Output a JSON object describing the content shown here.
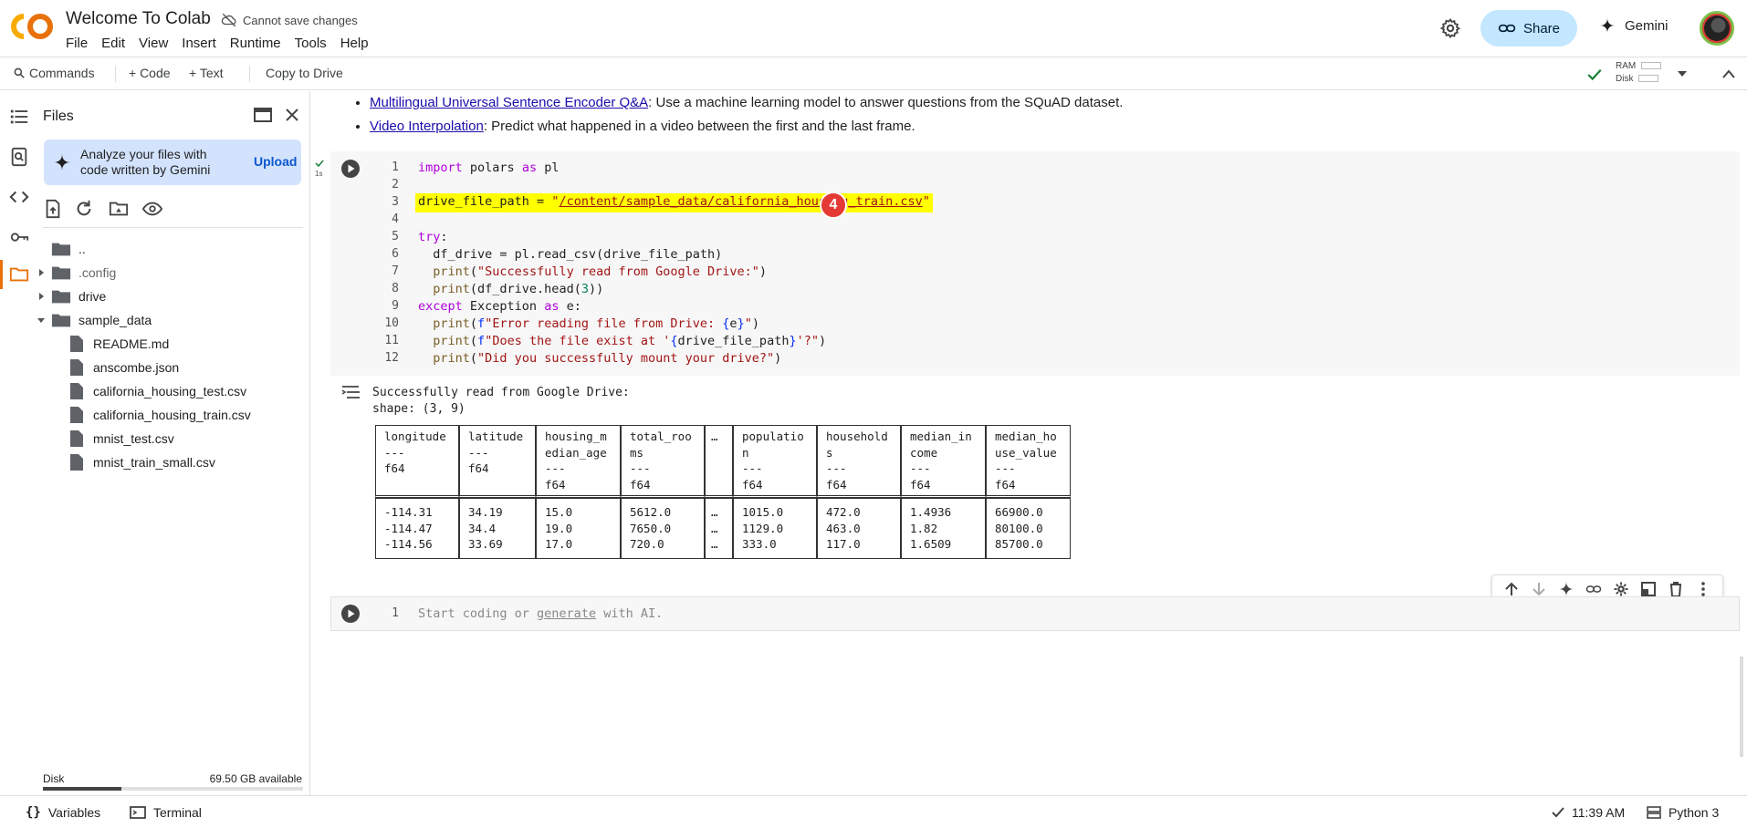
{
  "header": {
    "app_title": "Welcome To Colab",
    "save_status": "Cannot save changes",
    "menu": [
      "File",
      "Edit",
      "View",
      "Insert",
      "Runtime",
      "Tools",
      "Help"
    ],
    "share_label": "Share",
    "gemini_label": "Gemini"
  },
  "toolbar": {
    "commands": "Commands",
    "code": "+ Code",
    "text": "+ Text",
    "copy_to_drive": "Copy to Drive",
    "ram_label": "RAM",
    "disk_label": "Disk"
  },
  "files_panel": {
    "title": "Files",
    "gemini_card_text": "Analyze your files with code written by Gemini",
    "upload_label": "Upload",
    "tree": [
      {
        "name": "..",
        "type": "folder-up"
      },
      {
        "name": ".config",
        "type": "folder"
      },
      {
        "name": "drive",
        "type": "folder"
      },
      {
        "name": "sample_data",
        "type": "folder-open"
      },
      {
        "name": "README.md",
        "type": "file"
      },
      {
        "name": "anscombe.json",
        "type": "file"
      },
      {
        "name": "california_housing_test.csv",
        "type": "file"
      },
      {
        "name": "california_housing_train.csv",
        "type": "file"
      },
      {
        "name": "mnist_test.csv",
        "type": "file"
      },
      {
        "name": "mnist_train_small.csv",
        "type": "file"
      }
    ],
    "disk_label": "Disk",
    "disk_available": "69.50 GB available",
    "disk_used_fraction": 0.3
  },
  "markdown": {
    "item1_link": "Multilingual Universal Sentence Encoder Q&A",
    "item1_rest": ": Use a machine learning model to answer questions from the SQuAD dataset.",
    "item2_link": "Video Interpolation",
    "item2_rest": ": Predict what happened in a video between the first and the last frame."
  },
  "code_cell": {
    "exec_time": "1s",
    "badge": "4",
    "line_numbers": [
      "1",
      "2",
      "3",
      "4",
      "5",
      "6",
      "7",
      "8",
      "9",
      "10",
      "11",
      "12"
    ]
  },
  "output": {
    "line1": "Successfully read from Google Drive:",
    "line2": "shape: (3, 9)",
    "columns": [
      [
        "longitude",
        "---",
        "f64",
        ""
      ],
      [
        "latitude",
        "---",
        "f64",
        ""
      ],
      [
        "housing_m",
        "edian_age",
        "---",
        "f64"
      ],
      [
        "total_roo",
        "ms",
        "---",
        "f64"
      ],
      [
        "…",
        "",
        "",
        ""
      ],
      [
        "populatio",
        "n",
        "---",
        "f64"
      ],
      [
        "household",
        "s",
        "---",
        "f64"
      ],
      [
        "median_in",
        "come",
        "---",
        "f64"
      ],
      [
        "median_ho",
        "use_value",
        "---",
        "f64"
      ]
    ],
    "rows": [
      [
        "-114.31",
        "34.19",
        "15.0",
        "5612.0",
        "…",
        "1015.0",
        "472.0",
        "1.4936",
        "66900.0"
      ],
      [
        "-114.47",
        "34.4",
        "19.0",
        "7650.0",
        "…",
        "1129.0",
        "463.0",
        "1.82",
        "80100.0"
      ],
      [
        "-114.56",
        "33.69",
        "17.0",
        "720.0",
        "…",
        "333.0",
        "117.0",
        "1.6509",
        "85700.0"
      ]
    ]
  },
  "empty_cell": {
    "line_number": "1",
    "placeholder_pre": "Start coding or ",
    "placeholder_link": "generate",
    "placeholder_post": " with AI."
  },
  "statusbar": {
    "variables": "Variables",
    "terminal": "Terminal",
    "time": "11:39 AM",
    "runtime": "Python 3"
  }
}
